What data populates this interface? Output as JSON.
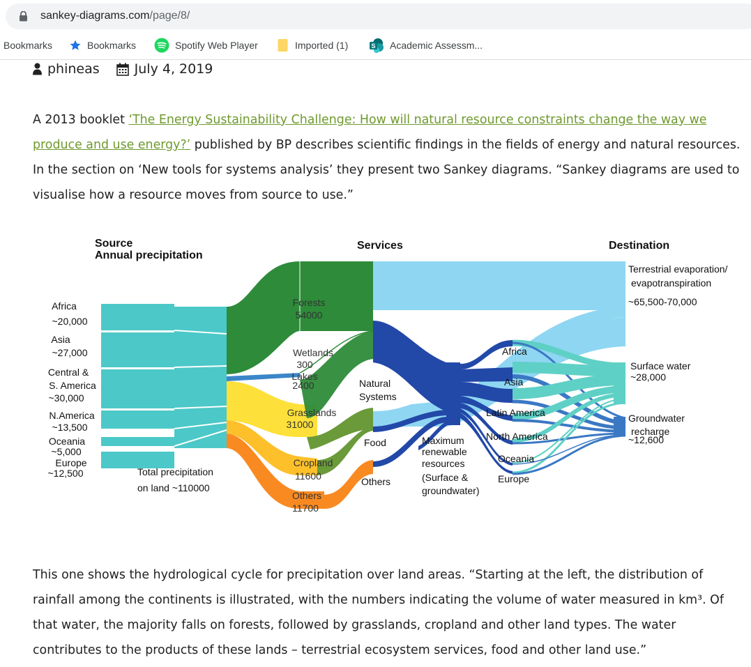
{
  "browser": {
    "url_host": "sankey-diagrams.com",
    "url_path": "/page/8/",
    "bookmarks": [
      {
        "label": "Bookmarks",
        "icon": "none"
      },
      {
        "label": "Bookmarks",
        "icon": "star-icon"
      },
      {
        "label": "Spotify Web Player",
        "icon": "spotify-icon"
      },
      {
        "label": "Imported (1)",
        "icon": "folder-icon"
      },
      {
        "label": "Academic Assessm...",
        "icon": "sharepoint-icon"
      }
    ]
  },
  "post": {
    "author": "phineas",
    "date": "July 4, 2019",
    "intro_before": "A 2013 booklet ",
    "intro_link": "‘The Energy Sustainability Challenge: How will natural resource constraints change the way we produce and use energy?’",
    "intro_after": " published by BP describes scientific findings in the fields of energy and natural resources. In the section on ‘New tools for systems analysis’ they present two Sankey diagrams. “Sankey diagrams are used to visualise how a resource moves from source to use.”",
    "outro": "This one shows the hydrological cycle for precipitation over land areas. “Starting at the left, the distribution of rainfall among the continents is illustrated, with the numbers indicating the volume of water measured in km³. Of that water, the majority falls on forests, followed by grasslands, cropland and other land types. The water contributes to the products of these lands – terrestrial ecosystem services, food and other land use.”"
  },
  "figure": {
    "headers": {
      "source_1": "Source",
      "source_2": "Annual precipitation",
      "services": "Services",
      "destination": "Destination"
    },
    "sources": [
      {
        "name": "Africa",
        "value": "~20,000"
      },
      {
        "name": "Asia",
        "value": "~27,000"
      },
      {
        "name": "Central & S. America",
        "name_1": "Central &",
        "name_2": "S. America",
        "value": "~30,000"
      },
      {
        "name": "N.America",
        "value": "~13,500"
      },
      {
        "name": "Oceania",
        "value": "~5,000"
      },
      {
        "name": "Europe",
        "value": "~12,500"
      }
    ],
    "total_1": "Total precipitation",
    "total_2": "on land ~110000",
    "land": [
      {
        "name": "Forests",
        "value": "54000",
        "color": "#2e8b3a"
      },
      {
        "name": "Wetlands",
        "value": "300",
        "color": "#2e8b3a"
      },
      {
        "name": "Lakes",
        "value": "2400",
        "color": "#3a86c8"
      },
      {
        "name": "Grasslands",
        "value": "31000",
        "color": "#fde13a"
      },
      {
        "name": "Cropland",
        "value": "11600",
        "color": "#fdc02a"
      },
      {
        "name": "Others",
        "value": "11700",
        "color": "#f98a22"
      }
    ],
    "services": {
      "natural_1": "Natural",
      "natural_2": "Systems",
      "food": "Food",
      "others": "Others"
    },
    "max_renewable": [
      "Maximum",
      "renewable",
      "resources",
      "(Surface &",
      "groundwater)"
    ],
    "regions": [
      "Africa",
      "Asia",
      "Latin America",
      "North America",
      "Oceania",
      "Europe"
    ],
    "destinations": {
      "evap_1": "Terrestrial evaporation/",
      "evap_2": "evapotranspiration",
      "evap_value": "~65,500-70,000",
      "surface_1": "Surface water",
      "surface_value": "~28,000",
      "ground_1": "Groundwater",
      "ground_2": "recharge",
      "ground_value": "~12,600"
    },
    "colors": {
      "source": "#4cc8c8",
      "forest": "#2e8b3a",
      "grass_service": "#6a9a3a",
      "evaporation": "#8fd6f2",
      "natural_systems": "#2248a8",
      "surface_water": "#5fd0c6",
      "groundwater": "#3a78c4"
    }
  }
}
